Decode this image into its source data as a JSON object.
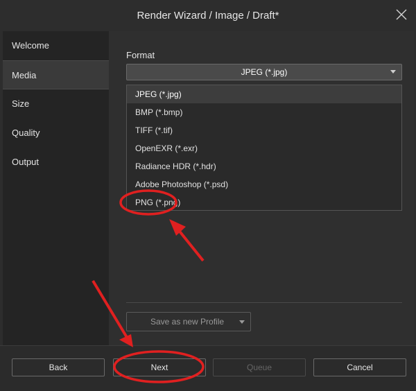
{
  "window": {
    "title": "Render Wizard / Image / Draft*"
  },
  "sidebar": {
    "items": [
      {
        "label": "Welcome"
      },
      {
        "label": "Media"
      },
      {
        "label": "Size"
      },
      {
        "label": "Quality"
      },
      {
        "label": "Output"
      }
    ],
    "active": "Media"
  },
  "main": {
    "format_label": "Format",
    "format_selected": "JPEG (*.jpg)",
    "options": [
      "JPEG (*.jpg)",
      "BMP (*.bmp)",
      "TIFF (*.tif)",
      "OpenEXR (*.exr)",
      "Radiance HDR (*.hdr)",
      "Adobe Photoshop (*.psd)",
      "PNG (*.png)"
    ],
    "profile_button": "Save as new Profile"
  },
  "footer": {
    "back": "Back",
    "next": "Next",
    "queue": "Queue",
    "cancel": "Cancel"
  },
  "colors": {
    "annotation": "#e02020",
    "background": "#2d2d2d"
  }
}
